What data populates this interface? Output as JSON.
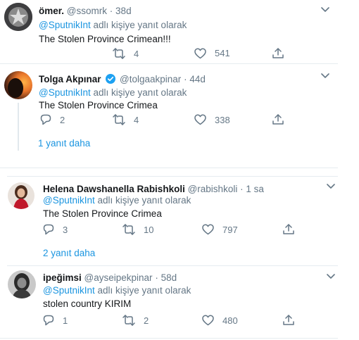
{
  "reply_label": "adlı kişiye yanıt olarak",
  "tweets": [
    {
      "name": "ömer.",
      "handle": "@ssomrk",
      "time": "38d",
      "mention": "@SputnikInt",
      "text": "The Stolen Province Crimean!!!",
      "replies": "",
      "retweets": "4",
      "likes": "541"
    },
    {
      "name": "Tolga Akpınar",
      "handle": "@tolgaakpinar",
      "time": "44d",
      "mention": "@SputnikInt",
      "text": "The Stolen Province Crimea",
      "replies": "2",
      "retweets": "4",
      "likes": "338",
      "verified": true
    },
    {
      "name": "Helena Dawshanella Rabishkoli",
      "handle": "@rabishkoli",
      "time": "1 sa",
      "mention": "@SputnikInt",
      "text": "The Stolen Province Crimea",
      "replies": "3",
      "retweets": "10",
      "likes": "797"
    },
    {
      "name": "ipeğimsi",
      "handle": "@ayseipekpinar",
      "time": "58d",
      "mention": "@SputnikInt",
      "text": "stolen country KIRIM",
      "replies": "1",
      "retweets": "2",
      "likes": "480"
    }
  ],
  "show_more_1": "1 yanıt daha",
  "show_more_2": "2 yanıt daha",
  "colors": {
    "link": "#1b95e0",
    "secondary": "#657786",
    "divider": "#e6ecf0",
    "verified": "#1da1f2"
  },
  "icons": [
    "reply-icon",
    "retweet-icon",
    "like-icon",
    "share-icon",
    "caret-down-icon",
    "verified-badge-icon"
  ]
}
